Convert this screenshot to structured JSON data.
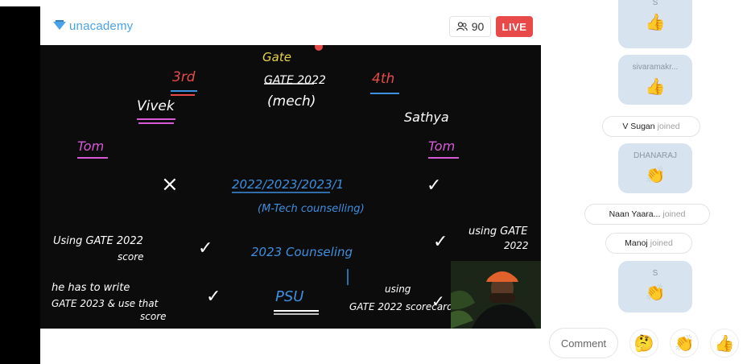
{
  "header": {
    "brand": "unacademy",
    "viewer_count": "90",
    "live_label": "LIVE"
  },
  "board_text": {
    "gate": "Gate",
    "gate2022": "GATE 2022",
    "mech": "(mech)",
    "rank3": "3rd",
    "rank4": "4th",
    "vivek": "Vivek",
    "sathya": "Sathya",
    "tom_left": "Tom",
    "tom_right": "Tom",
    "cross": "×",
    "dates": "2022/2023/2023/1",
    "mtech": "(M-Tech counselling)",
    "using_gate_left": "Using GATE 2022",
    "score_left": "score",
    "counseling2023": "2023 Counseling",
    "using_gate_right": "using GATE",
    "year_right": "2022",
    "he_has": "he has to write",
    "gate2023": "GATE 2023 & use that",
    "score_bottom": "score",
    "psu": "PSU",
    "using_bottom": "using",
    "gate_scorecard": "GATE 2022 scorecard",
    "ticks": [
      "✓",
      "✓",
      "✓",
      "✓",
      "✓"
    ]
  },
  "chat": {
    "items": [
      {
        "type": "reaction",
        "name": "S",
        "emoji": "👍"
      },
      {
        "type": "reaction",
        "name": "sivaramakr...",
        "emoji": "👍"
      },
      {
        "type": "joined",
        "name": "V Sugan",
        "status": "joined"
      },
      {
        "type": "reaction",
        "name": "DHANARAJ",
        "emoji": "👏"
      },
      {
        "type": "joined",
        "name": "Naan Yaara...",
        "status": "joined"
      },
      {
        "type": "joined",
        "name": "Manoj",
        "status": "joined"
      },
      {
        "type": "reaction",
        "name": "S",
        "emoji": "👏"
      }
    ]
  },
  "composer": {
    "placeholder": "Comment",
    "reactions": [
      "🤔",
      "👏",
      "👍"
    ]
  },
  "colors": {
    "live": "#e84a4a",
    "brand": "#4aa3e8",
    "bubble": "#d7e3ef",
    "board": "#0c0c0c"
  }
}
